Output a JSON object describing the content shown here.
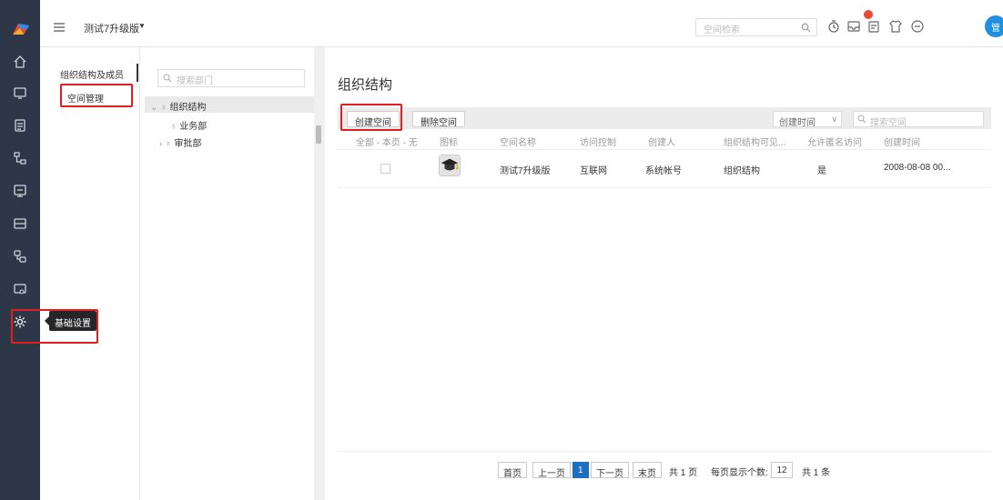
{
  "header": {
    "space_name": "测试7升级版",
    "space_caret": "▼",
    "search_placeholder": "空间检索",
    "avatar_label": "管"
  },
  "subnav": {
    "items": [
      {
        "label": "组织结构及成员"
      },
      {
        "label": "空间管理"
      }
    ]
  },
  "dept_panel": {
    "search_placeholder": "搜索部门",
    "tree": [
      {
        "label": "组织结构",
        "prefix": "⌄ ♁"
      },
      {
        "label": "业务部",
        "prefix": "♁"
      },
      {
        "label": "审批部",
        "prefix": "› ♁"
      }
    ]
  },
  "main": {
    "title": "组织结构",
    "toolbar": {
      "create_label": "创建空间",
      "delete_label": "删除空间",
      "sort_label": "创建时间",
      "sort_caret": "∨",
      "search_placeholder": "搜索空间"
    },
    "columns": [
      "全部 - 本页 - 无",
      "图标",
      "空间名称",
      "访问控制",
      "创建人",
      "组织结构可见...",
      "允许匿名访问",
      "创建时间"
    ],
    "rows": [
      {
        "name": "测试7升级版",
        "access": "互联网",
        "creator": "系统帐号",
        "org_visible": "组织结构",
        "anonymous": "是",
        "created": "2008-08-08 00..."
      }
    ],
    "pager": {
      "first": "首页",
      "prev": "上一页",
      "current": "1",
      "next": "下一页",
      "last": "末页",
      "total_pages": "共 1 页",
      "per_page_label": "每页显示个数:",
      "per_page_value": "12",
      "total_items": "共 1 条"
    }
  },
  "tooltip": {
    "text": "基础设置"
  },
  "colors": {
    "rail_bg": "#2e3747",
    "highlight": "#e02020",
    "accent": "#1e6fc1",
    "avatar": "#1e8fe1",
    "badge": "#e84c3d"
  },
  "icons": {
    "rail": [
      "home-icon",
      "monitor-icon",
      "document-list-icon",
      "org-icon",
      "screen-icon",
      "card-icon",
      "link-icon",
      "display-icon",
      "gear-icon"
    ],
    "top": [
      "search-icon",
      "timer-icon",
      "inbox-icon",
      "notes-icon",
      "shirt-icon",
      "more-icon"
    ]
  }
}
